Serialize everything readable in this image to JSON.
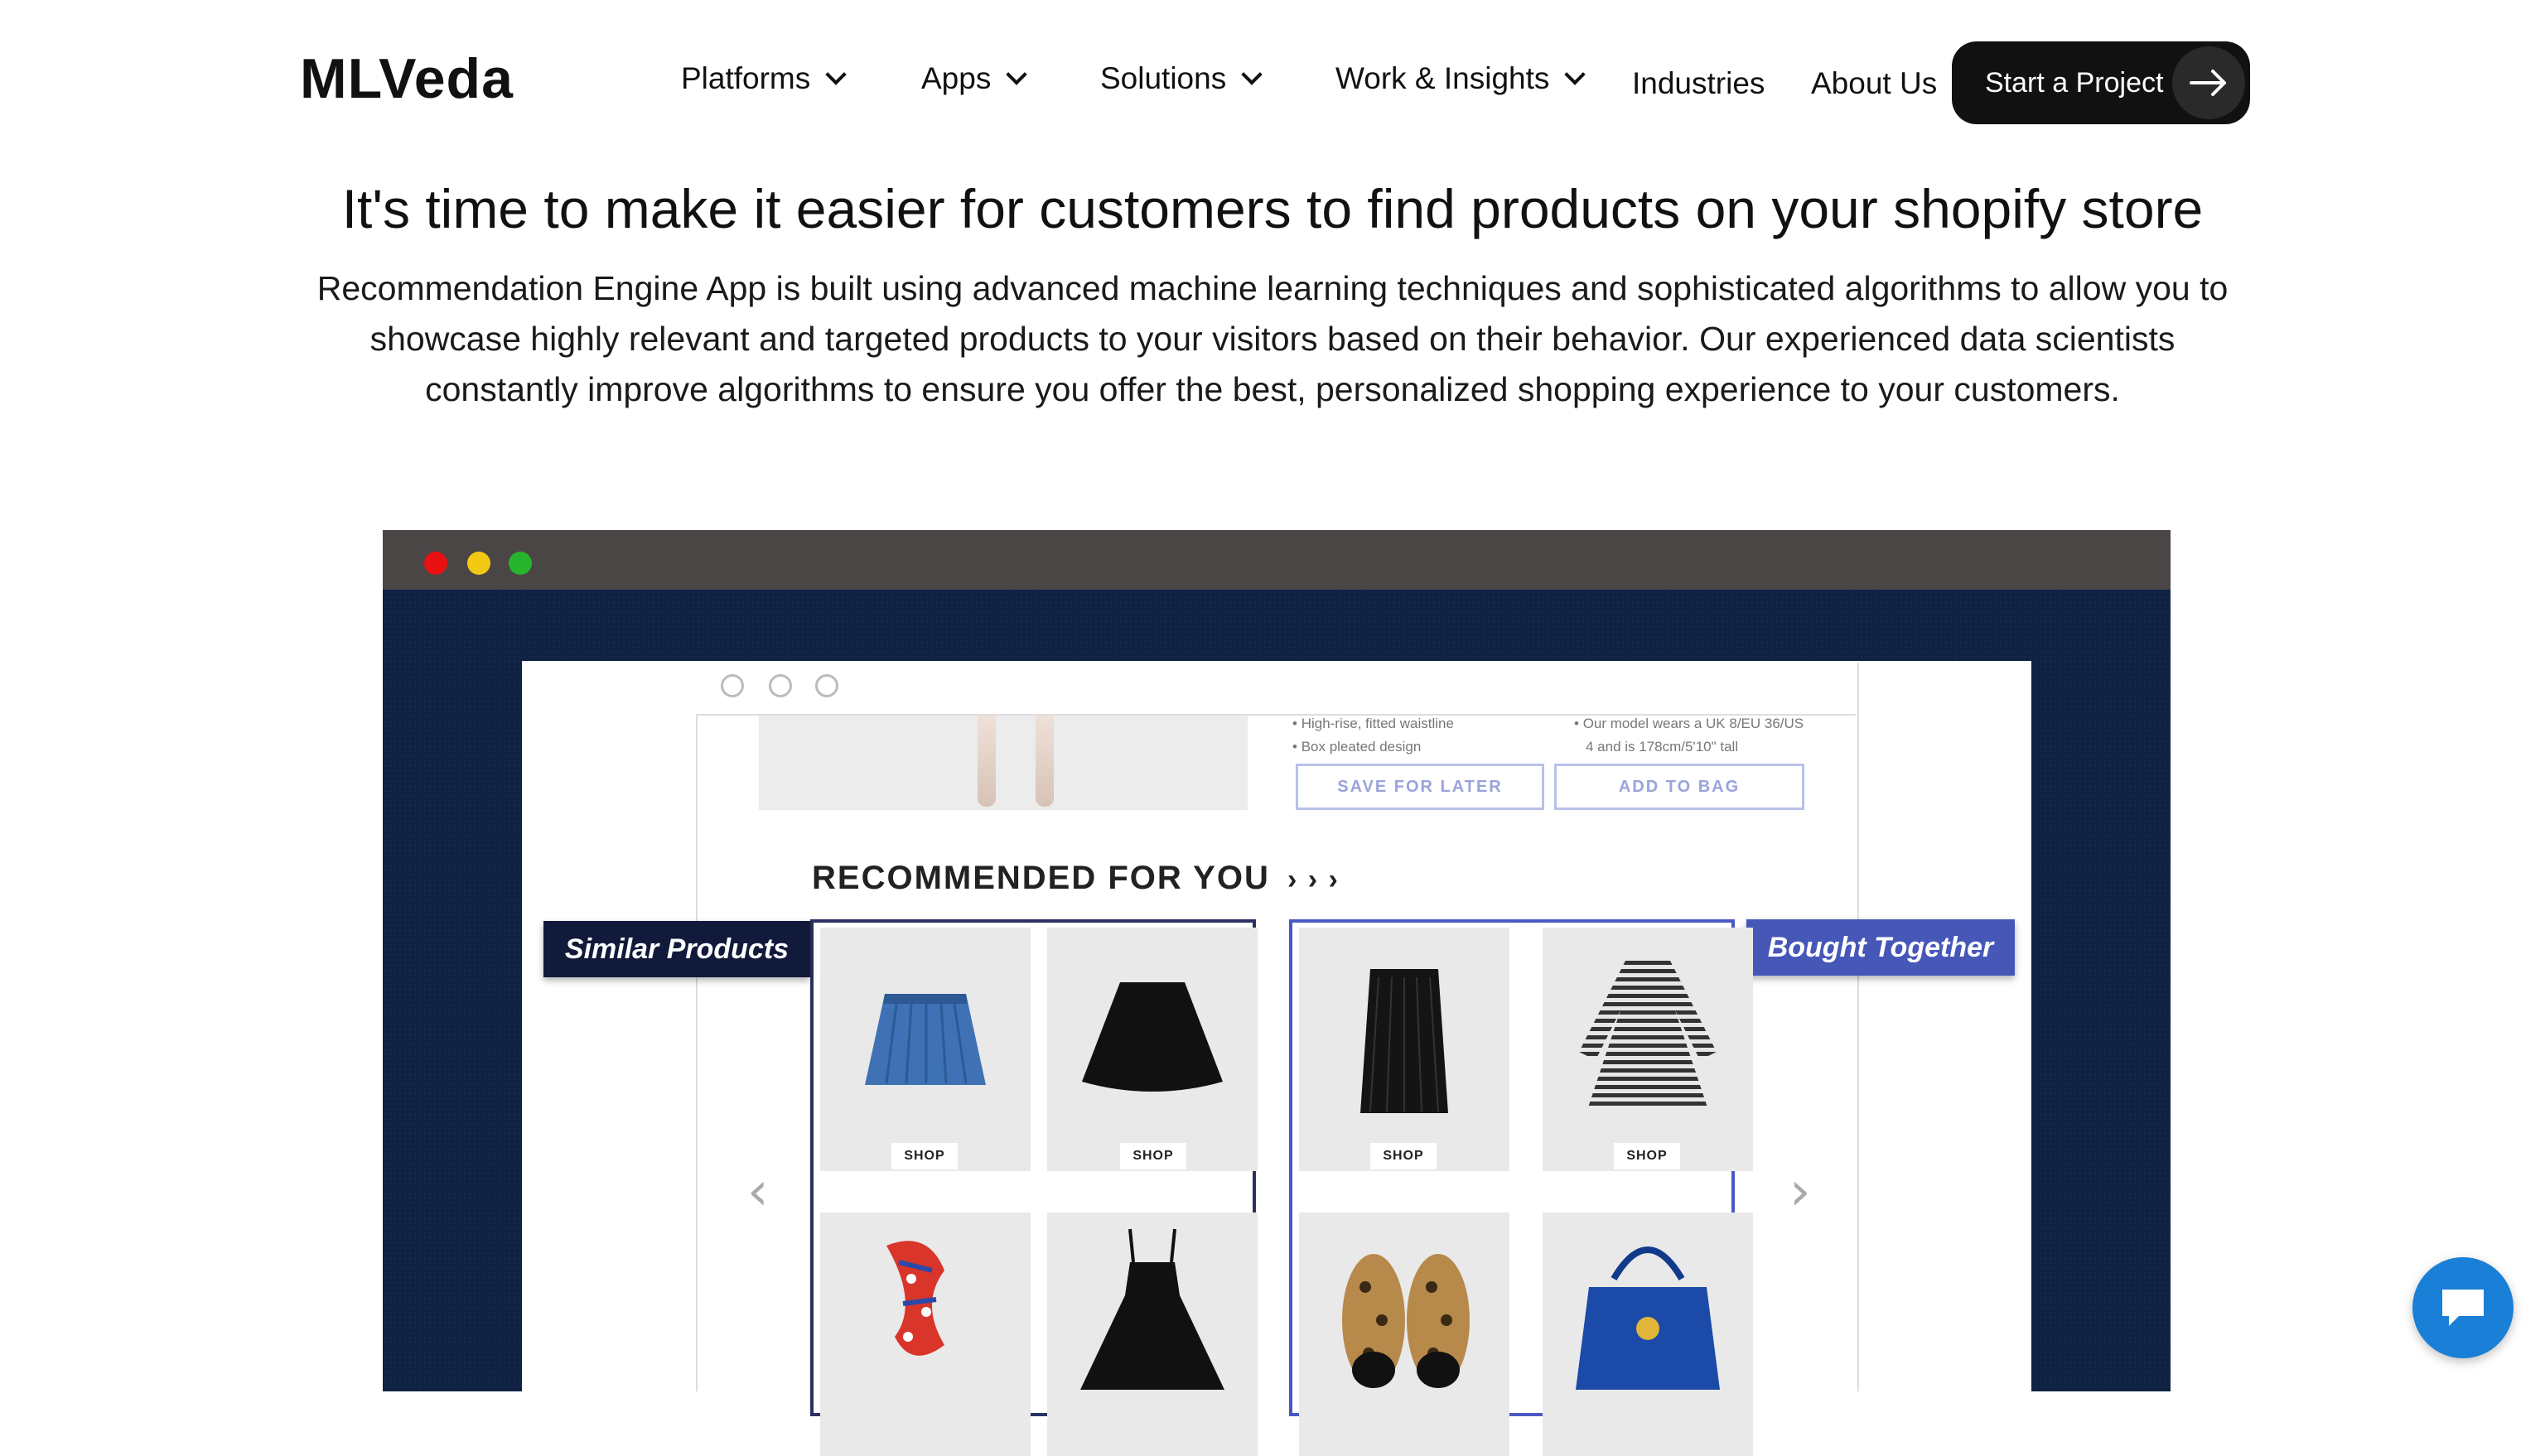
{
  "header": {
    "logo": "MLVeda",
    "nav": [
      {
        "label": "Platforms"
      },
      {
        "label": "Apps"
      },
      {
        "label": "Solutions"
      },
      {
        "label": "Work & Insights"
      },
      {
        "label": "Industries"
      },
      {
        "label": "About Us"
      }
    ],
    "cta_label": "Start a Project"
  },
  "hero": {
    "headline": "It's time to make it easier for customers to find products on your shopify store",
    "body_line1": "Recommendation Engine App is built using advanced machine learning techniques and sophisticated algorithms to allow you to",
    "body_line2": "showcase highly relevant and targeted products to your visitors based on their behavior. Our experienced data scientists",
    "body_line3": "constantly improve algorithms to ensure you offer the best, personalized shopping experience to your customers."
  },
  "mockup": {
    "window_dot_colors": [
      "#e81010",
      "#f2c812",
      "#27b52d"
    ],
    "product_bullets": [
      "High-rise, fitted waistline",
      "Box pleated design"
    ],
    "model_info_1": "Our model wears a UK 8/EU 36/US",
    "model_info_2": "4 and is 178cm/5'10\" tall",
    "save_for_later": "SAVE FOR LATER",
    "add_to_bag": "ADD TO BAG",
    "recommended_title": "RECOMMENDED FOR YOU",
    "recommended_arrows": "› › ›",
    "tag_similar": "Similar Products",
    "tag_bought": "Bought Together",
    "shop_label": "SHOP",
    "similar_products": [
      "blue-pleated-skirt",
      "black-flared-skirt",
      "red-scarf",
      "black-dress"
    ],
    "bought_together": [
      "black-pleated-skirt",
      "striped-dress",
      "leopard-loafers",
      "blue-handbag"
    ],
    "accent_dark": "#2b3160",
    "accent_blue": "#4a58c4",
    "nav_prev": "‹",
    "nav_next": "›"
  },
  "chat_widget": {
    "icon": "chat-bubble-icon",
    "color": "#1a7fd6"
  }
}
